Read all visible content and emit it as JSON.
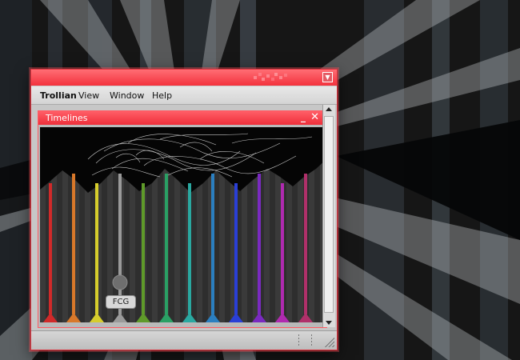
{
  "app": {
    "title": "Trollian",
    "menu_button_icon": "chevron-down-icon",
    "menus": [
      "Trollian",
      "View",
      "Window",
      "Help"
    ]
  },
  "panel": {
    "title": "Timelines",
    "minimize_label": "_",
    "close_label": "✕"
  },
  "timelines": {
    "selected_label": "FCG",
    "selected_index": 3,
    "colors": [
      "#d02a2a",
      "#d8782a",
      "#d6cd2c",
      "#9a9a9a",
      "#5f9a2a",
      "#2aa064",
      "#2aa8a0",
      "#2b7fc0",
      "#2a3fd6",
      "#7a2ac0",
      "#b02ab0",
      "#b0306a"
    ]
  },
  "theme": {
    "accent": "#f3323d",
    "window_bg": "#c7c7c7"
  }
}
